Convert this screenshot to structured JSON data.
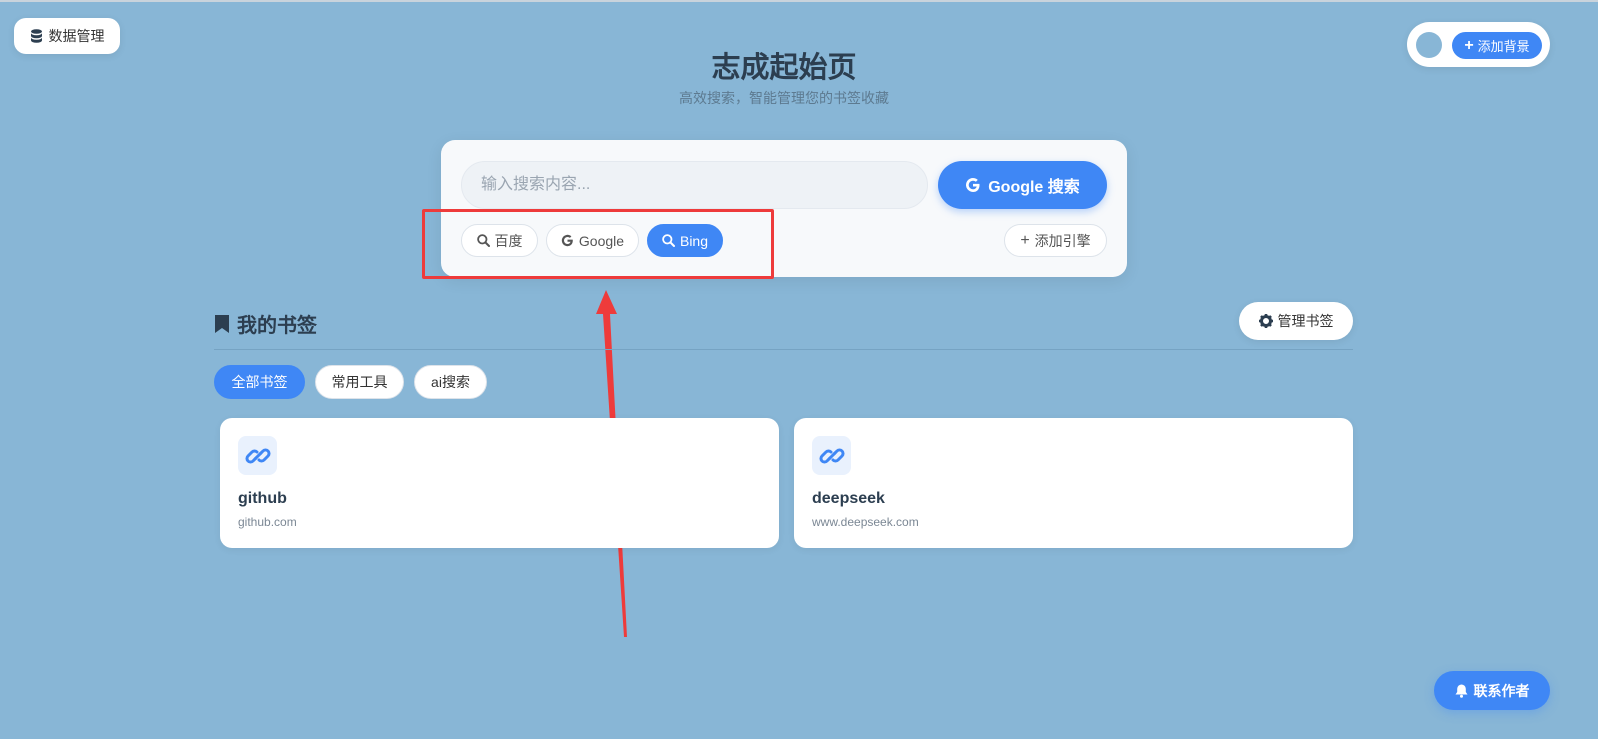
{
  "top_left": {
    "data_mgmt_label": "数据管理",
    "icon": "database-icon"
  },
  "top_right": {
    "add_bg_label": "添加背景",
    "icon": "plus-icon"
  },
  "header": {
    "title": "志成起始页",
    "subtitle": "高效搜索，智能管理您的书签收藏"
  },
  "search": {
    "placeholder": "输入搜索内容...",
    "button_label": "Google 搜索",
    "engines": [
      {
        "label": "百度",
        "icon": "search-icon",
        "active": false
      },
      {
        "label": "Google",
        "icon": "google-icon",
        "active": false
      },
      {
        "label": "Bing",
        "icon": "search-icon",
        "active": true
      }
    ],
    "add_engine_label": "添加引擎"
  },
  "bookmarks": {
    "title": "我的书签",
    "manage_label": "管理书签",
    "categories": [
      {
        "label": "全部书签",
        "active": true
      },
      {
        "label": "常用工具",
        "active": false
      },
      {
        "label": "ai搜索",
        "active": false
      }
    ],
    "items": [
      {
        "name": "github",
        "url": "github.com",
        "icon": "link-icon"
      },
      {
        "name": "deepseek",
        "url": "www.deepseek.com",
        "icon": "link-icon"
      }
    ]
  },
  "contact": {
    "label": "联系作者",
    "icon": "bell-icon"
  },
  "colors": {
    "background": "#88b6d6",
    "accent": "#3f87f5",
    "annotation": "#ee3b3b"
  }
}
